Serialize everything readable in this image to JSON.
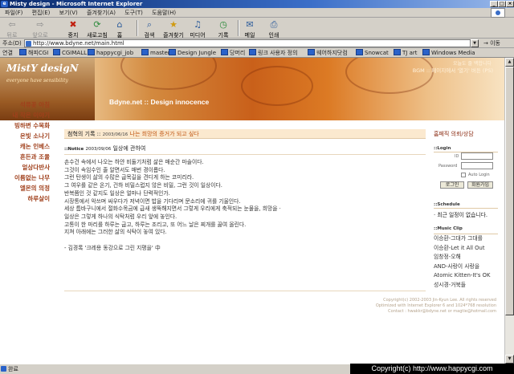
{
  "window": {
    "title": "Misty design - Microsoft Internet Explorer",
    "buttons": [
      "_",
      "□",
      "×"
    ]
  },
  "menu": [
    "파일(F)",
    "편집(E)",
    "보기(V)",
    "즐겨찾기(A)",
    "도구(T)",
    "도움말(H)"
  ],
  "toolbar": {
    "back": "뒤로",
    "forward": "앞으로",
    "stop": "중지",
    "refresh": "새로고침",
    "home": "홈",
    "search": "검색",
    "favorites": "즐겨찾기",
    "media": "미디어",
    "history": "기록",
    "mail": "메일",
    "print": "인쇄"
  },
  "address": {
    "label": "주소(D)",
    "url": "http://www.bdyne.net/main.html",
    "go": "이동"
  },
  "links": {
    "label": "연결",
    "items": [
      "해피CGI",
      "CGIMALL",
      "happycgi_job",
      "master",
      "Design Jungle",
      "당머리",
      "링크 사용자 정의",
      "웨어하지닷컴",
      "Snowcat",
      "TJ art",
      "Windows Media"
    ]
  },
  "banner": {
    "logo_title": "MistY desigN",
    "logo_subtitle": "everyone have sensibility",
    "top_small": "오늘도 줄 백합니다",
    "top_text": "BGM :: 페이지에서 '열기' 버튼 (PS)",
    "page_title": "Bdyne.net :: Design innocence"
  },
  "side_menu": [
    "석류꽃 아침",
    "내 작은 이야기",
    "빙하변 수목화",
    "온빛 소나기",
    "캐논 인베스",
    "흔든과 조율",
    "얼상다반사",
    "이름없는 나무",
    "엘몬의 의정",
    "하루살이"
  ],
  "crumb": {
    "label": "첨혁의 기록 ::",
    "date": "2003/06/16",
    "title": "나는 희망의 증거가 되고 싶다"
  },
  "notice": {
    "tag": "::Notice",
    "date": "2003/09/06",
    "title": "일상에 관하여"
  },
  "post_lines": [
    "손수건 속에서 나오는 하얀 비둘기처럼 삶은 매순간 마술이다.",
    "그것이 속임수인 줄 알면서도 매번 경이롭다.",
    "그런 탄생이 삶의 수많은 굽목길을 견디게 하는 코미리라.",
    "그 여우를 같은 온기, 건하 비밀스럽지 않은 비밀, 그런 것이 일상이다.",
    "반복쯤인 것 같지도 일상은 얼마나 단력적인가.",
    "시장통에서 악쓰며 싸우다가 저녁이면 밥을 기다리며 문소리에 귀를 기울인다.",
    "세상 틈바구니에서 절화수목금에 급새 생뚝해지면서 그렇게 우리에게 축적되는 눈물을, 희망을 ·",
    "일상은 그렇게 하나의 식탁처럼 우리 앞에 놓인다.",
    "고통이 한 마리를 하루는 굽고, 하루는 조리고, 또 어느 날은 찌개를 끓여 올린다.",
    "지쳐 아래에는 그러한 삶의 식탁이 놓여 있다.",
    "",
    "- 김경록 '크레용 동강으로 그린 지평을' 中"
  ],
  "right": {
    "top_link": "홈페직 의뢰/상담",
    "login_tag": "::Login",
    "id_label": "ID",
    "pw_label": "Password",
    "auto_login": "Auto Login",
    "login_btn": "로그인",
    "join_btn": "회원가입",
    "schedule_tag": "::Schedule",
    "schedule_text": "최근 일정이 없습니다.",
    "music_tag": "::Music Clip",
    "music": [
      "이승환-그대가 그대를",
      "이승환-Let it All Out",
      "임창정-오해",
      "AND-사랑이 사랑을",
      "Atomic Kitten-It's OK",
      "성시경-거북들"
    ]
  },
  "footer": [
    "Copyright(c) 2002-2003 Jin-Kyun Lee. All rights reserved",
    "Optimized with Internet Explorer 6 and 1024*768 resolution",
    "Contact : hwakkr@bdyne.net or magtie@hotmail.com"
  ],
  "status": {
    "text": "완료",
    "copyright": "Copyright(c) http://www.happycgi.com"
  }
}
